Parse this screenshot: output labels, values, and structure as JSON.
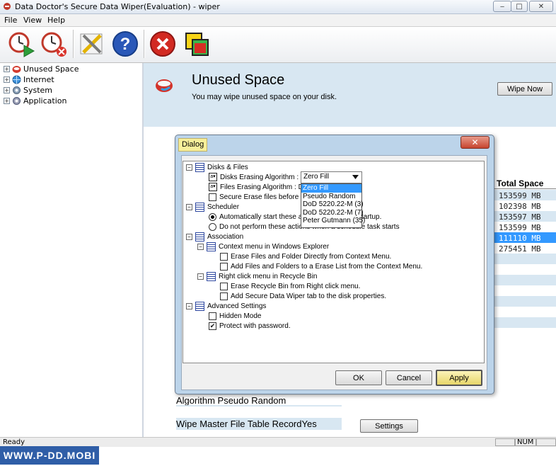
{
  "window": {
    "title": "Data Doctor's Secure Data Wiper(Evaluation) - wiper",
    "min_glyph": "‒",
    "max_glyph": "□",
    "close_glyph": "✕"
  },
  "menu": [
    "File",
    "View",
    "Help"
  ],
  "toolbar": {
    "buttons": [
      {
        "name": "schedule-start",
        "icon": "clock-play-icon"
      },
      {
        "name": "schedule-stop",
        "icon": "clock-stop-icon"
      },
      {
        "name": "settings",
        "icon": "tools-icon"
      },
      {
        "name": "help",
        "icon": "question-icon"
      },
      {
        "name": "exit",
        "icon": "stop-icon"
      },
      {
        "name": "about",
        "icon": "window-icon"
      }
    ]
  },
  "tree": {
    "items": [
      {
        "label": "Unused Space",
        "icon": "disk-icon"
      },
      {
        "label": "Internet",
        "icon": "globe-icon"
      },
      {
        "label": "System",
        "icon": "gear-icon"
      },
      {
        "label": "Application",
        "icon": "gear-icon"
      }
    ]
  },
  "main": {
    "title": "Unused Space",
    "description": "You may wipe unused space on your disk.",
    "wipe_button": "Wipe Now",
    "total_space_header": "Total Space",
    "total_space_values": [
      "153599 MB",
      "102398 MB",
      "153597 MB",
      "153599 MB",
      "111110 MB",
      "275451 MB"
    ],
    "algorithm_label": "Algorithm Pseudo Random",
    "mft_label": "Wipe Master File Table RecordYes",
    "settings_button": "Settings"
  },
  "dialog": {
    "title": "Dialog",
    "close_glyph": "✕",
    "nodes": {
      "disks_files": "Disks & Files",
      "disks_algo": "Disks Erasing Algorithm :",
      "files_algo": "Files Erasing Algorithm : D",
      "secure_erase": "Secure Erase files before d",
      "scheduler": "Scheduler",
      "auto_start": "Automatically start these a",
      "auto_start_tail": "startup.",
      "no_perform": "Do not perform these actions when a schedule task starts",
      "association": "Association",
      "context_menu": "Context menu in Windows Explorer",
      "erase_direct": "Erase Files and Folder Directly from Context Menu.",
      "add_erase_list": "Add Files and Folders to a Erase List from the Context Menu.",
      "recycle_menu": "Right click menu in Recycle Bin",
      "erase_recycle": "Erase Recycle Bin from Right click menu.",
      "add_tab": "Add Secure Data Wiper tab to the disk properties.",
      "advanced": "Advanced Settings",
      "hidden_mode": "Hidden Mode",
      "protect_password": "Protect with password."
    },
    "algo_icon_text": "a▾",
    "dropdown_selected": "Zero Fill",
    "dropdown_options": [
      "Zero Fill",
      "Pseudo Random",
      "DoD 5220.22-M (3)",
      "DoD 5220.22-M (7)",
      "Peter Gutmann (35)"
    ],
    "ok": "OK",
    "cancel": "Cancel",
    "apply": "Apply",
    "check_glyph": "✔"
  },
  "status": {
    "text": "Ready",
    "num": "NUM"
  },
  "watermark": "WWW.P-DD.MOBI",
  "colors": {
    "header_band": "#d8e7f2",
    "selection": "#3399ff",
    "dialog_bg": "#bcd4ea",
    "apply_accent": "#f5e98a"
  }
}
